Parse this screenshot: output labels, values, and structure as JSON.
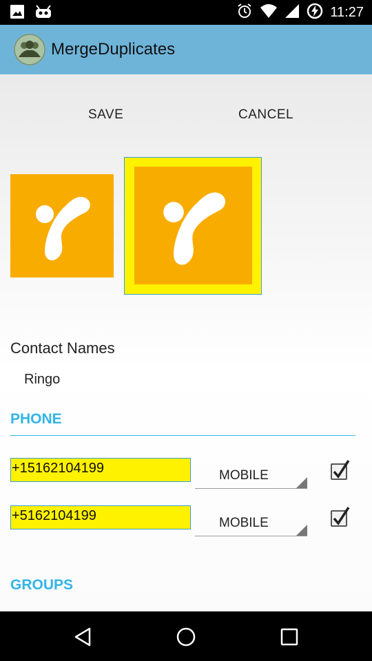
{
  "status_bar": {
    "time": "11:27",
    "left_icons": [
      "image-icon",
      "android-debug-icon"
    ],
    "right_icons": [
      "alarm-icon",
      "wifi-icon",
      "signal-icon",
      "battery-charging-icon"
    ]
  },
  "app_bar": {
    "title": "MergeDuplicates",
    "icon": "contacts-group-icon"
  },
  "actions": {
    "save": "SAVE",
    "cancel": "CANCEL"
  },
  "photos": [
    {
      "icon": "phone-handset-icon",
      "selected": false,
      "color": "#f8ac00"
    },
    {
      "icon": "phone-handset-icon",
      "selected": true,
      "color": "#f8ac00",
      "highlight": "#fff200"
    }
  ],
  "contact_names": {
    "label": "Contact Names",
    "value": "Ringo"
  },
  "phone": {
    "header": "PHONE",
    "entries": [
      {
        "number": "+15162104199",
        "type": "MOBILE",
        "checked": true
      },
      {
        "number": "+5162104199",
        "type": "MOBILE",
        "checked": true
      }
    ]
  },
  "groups": {
    "header": "GROUPS"
  },
  "colors": {
    "accent": "#33b5e5",
    "app_bar": "#6eb4d9",
    "field_highlight": "#fff200",
    "photo_bg": "#f8ac00"
  },
  "nav_bar": [
    "back-icon",
    "home-icon",
    "recents-icon"
  ]
}
